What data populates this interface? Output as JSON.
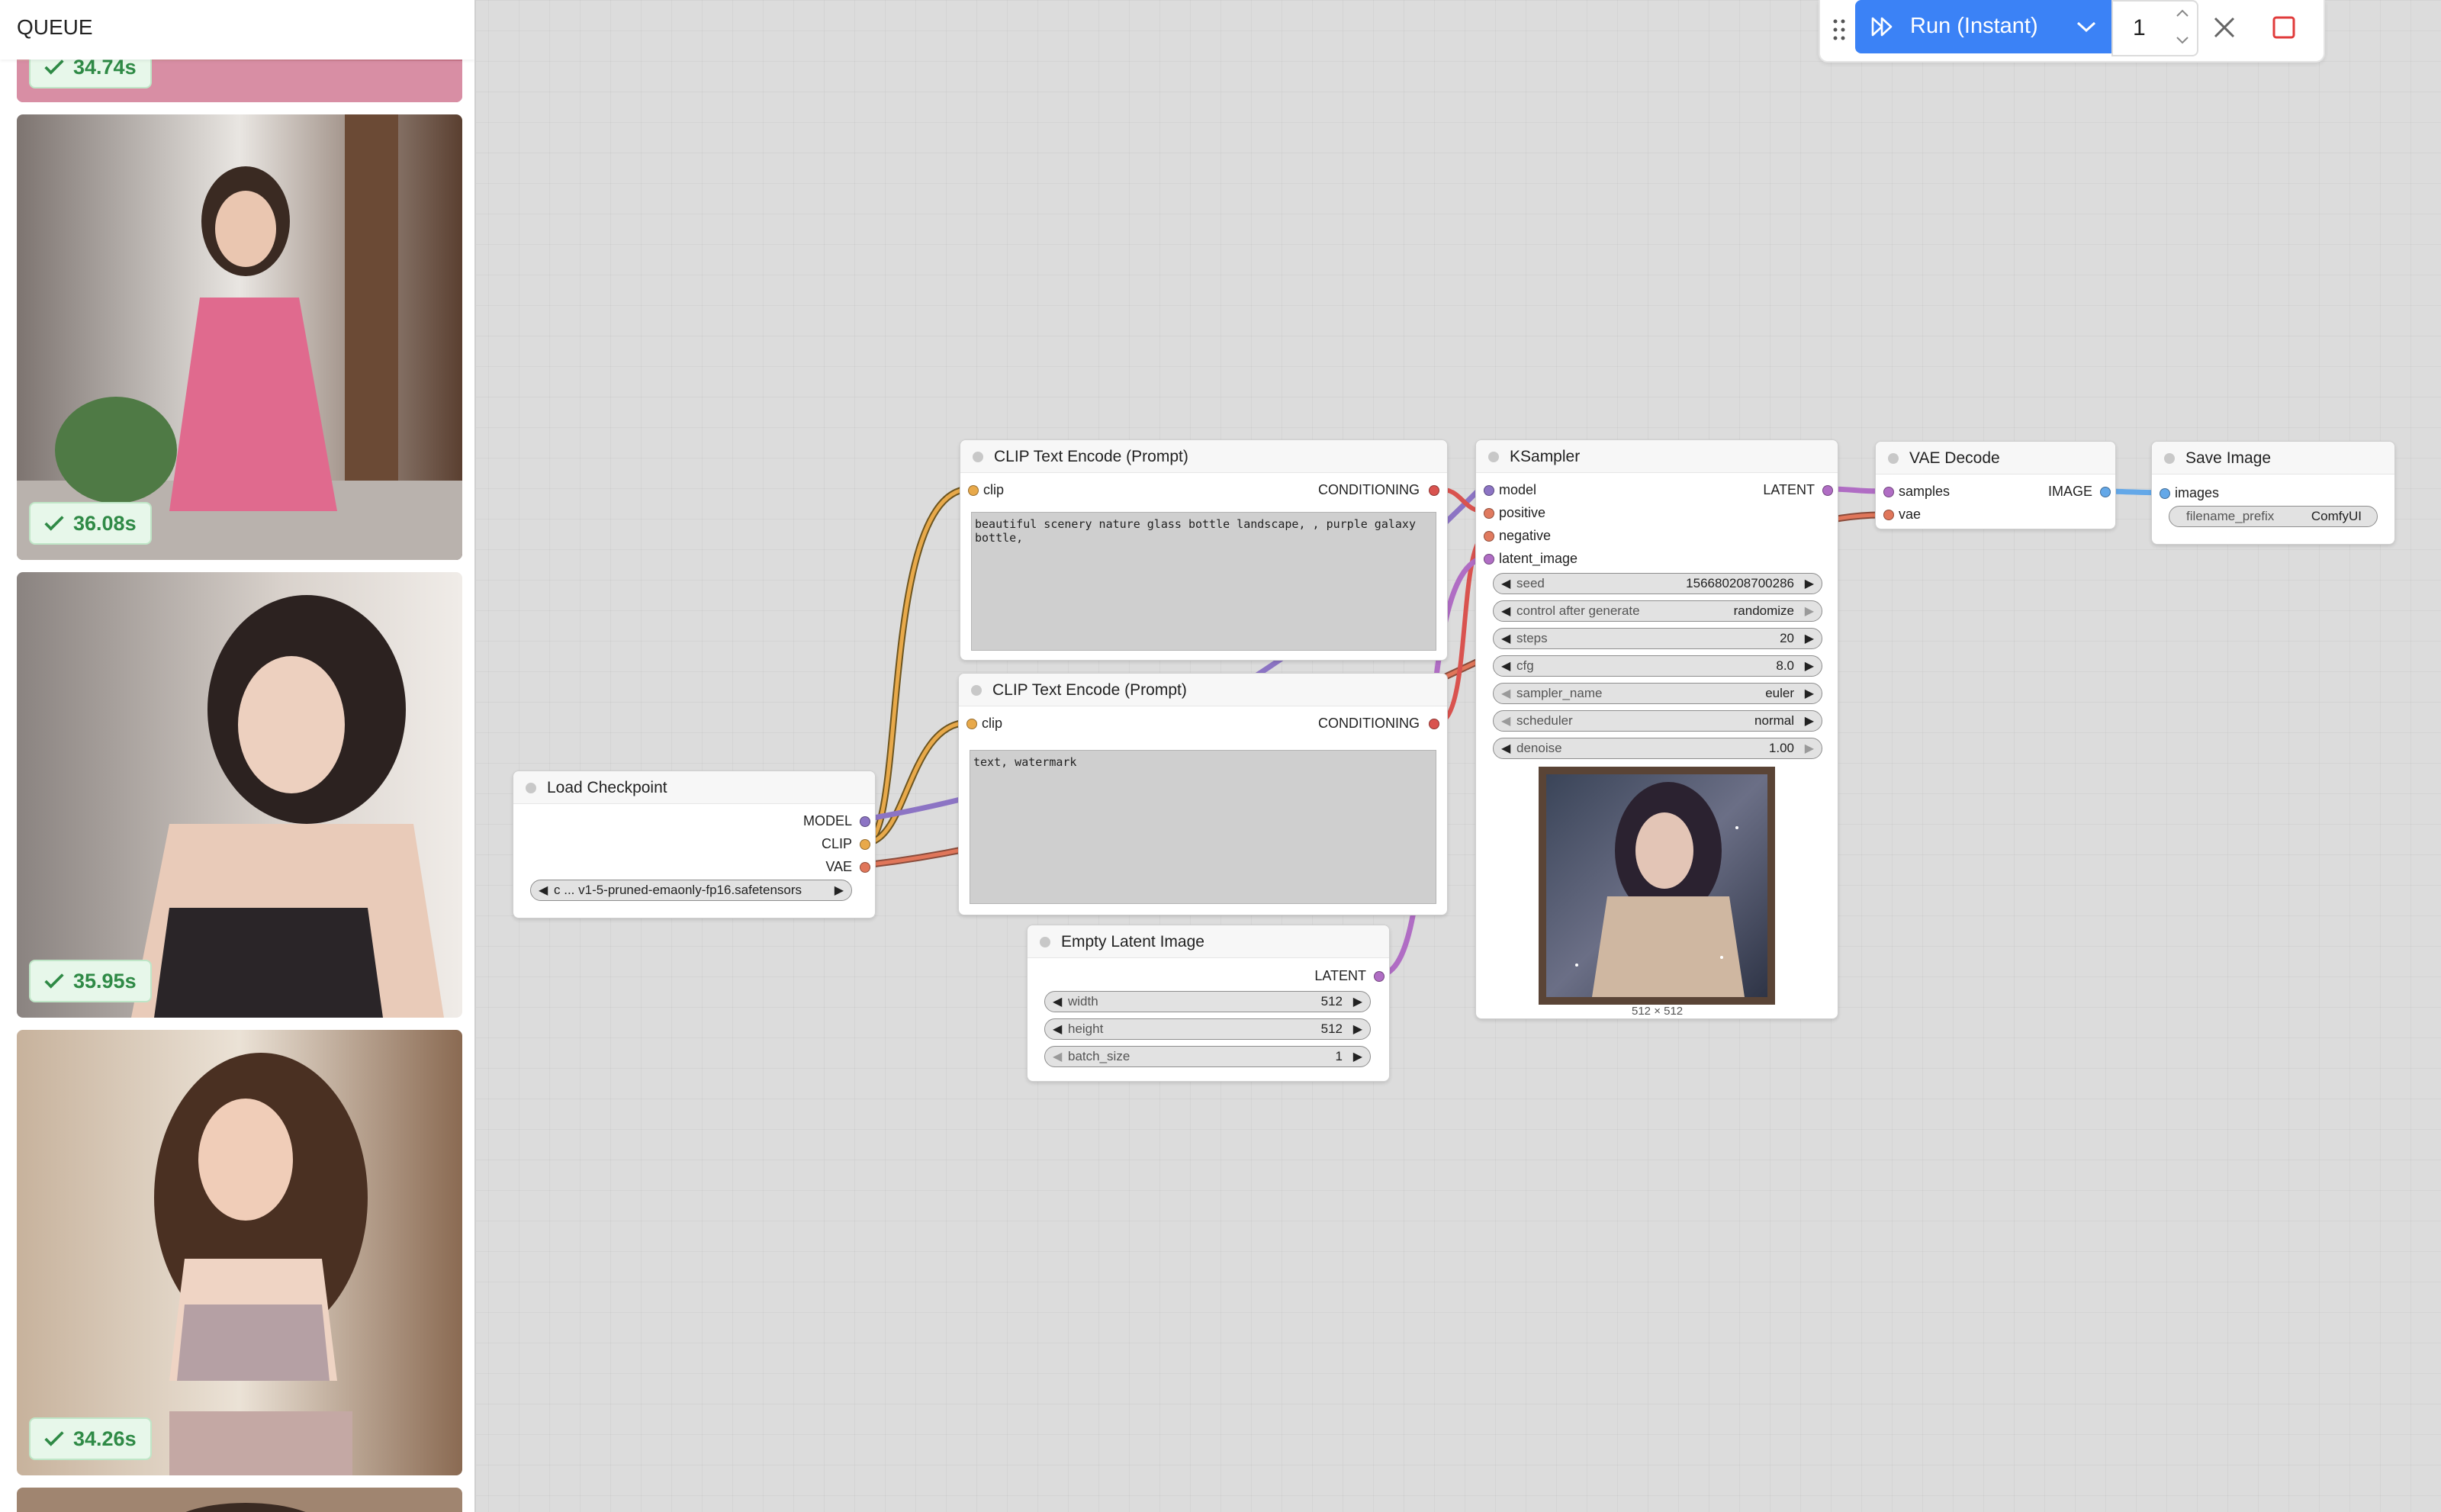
{
  "queue": {
    "title": "QUEUE",
    "items": [
      {
        "duration": "34.74s"
      },
      {
        "duration": "36.08s"
      },
      {
        "duration": "35.95s"
      },
      {
        "duration": "34.26s"
      }
    ]
  },
  "toolbar": {
    "run_label": "Run (Instant)",
    "batch_count": "1"
  },
  "nodes": {
    "clip_pos": {
      "title": "CLIP Text Encode (Prompt)",
      "input": "clip",
      "output": "CONDITIONING",
      "text": "beautiful scenery nature glass bottle landscape, , purple galaxy bottle,"
    },
    "clip_neg": {
      "title": "CLIP Text Encode (Prompt)",
      "input": "clip",
      "output": "CONDITIONING",
      "text": "text, watermark"
    },
    "checkpoint": {
      "title": "Load Checkpoint",
      "outputs": [
        "MODEL",
        "CLIP",
        "VAE"
      ],
      "ckpt_value": "c ... v1-5-pruned-emaonly-fp16.safetensors"
    },
    "latent": {
      "title": "Empty Latent Image",
      "output": "LATENT",
      "widgets": [
        {
          "name": "width",
          "value": "512"
        },
        {
          "name": "height",
          "value": "512"
        },
        {
          "name": "batch_size",
          "value": "1"
        }
      ]
    },
    "ksampler": {
      "title": "KSampler",
      "inputs": [
        "model",
        "positive",
        "negative",
        "latent_image"
      ],
      "output": "LATENT",
      "widgets": [
        {
          "name": "seed",
          "value": "156680208700286"
        },
        {
          "name": "control after generate",
          "value": "randomize"
        },
        {
          "name": "steps",
          "value": "20"
        },
        {
          "name": "cfg",
          "value": "8.0"
        },
        {
          "name": "sampler_name",
          "value": "euler"
        },
        {
          "name": "scheduler",
          "value": "normal"
        },
        {
          "name": "denoise",
          "value": "1.00"
        }
      ],
      "preview_caption": "512 × 512"
    },
    "vae_decode": {
      "title": "VAE Decode",
      "inputs": [
        "samples",
        "vae"
      ],
      "output": "IMAGE"
    },
    "save_image": {
      "title": "Save Image",
      "input": "images",
      "widget": {
        "name": "filename_prefix",
        "value": "ComfyUI"
      }
    }
  },
  "colors": {
    "accent": "#3b82f6",
    "clip_link": "#e8a94a",
    "model_link": "#8c74c4",
    "vae_link": "#e0765a",
    "conditioning_link": "#d9534f",
    "latent_link": "#b06dc4",
    "image_link": "#64a8e8",
    "success": "#2f8a46"
  }
}
